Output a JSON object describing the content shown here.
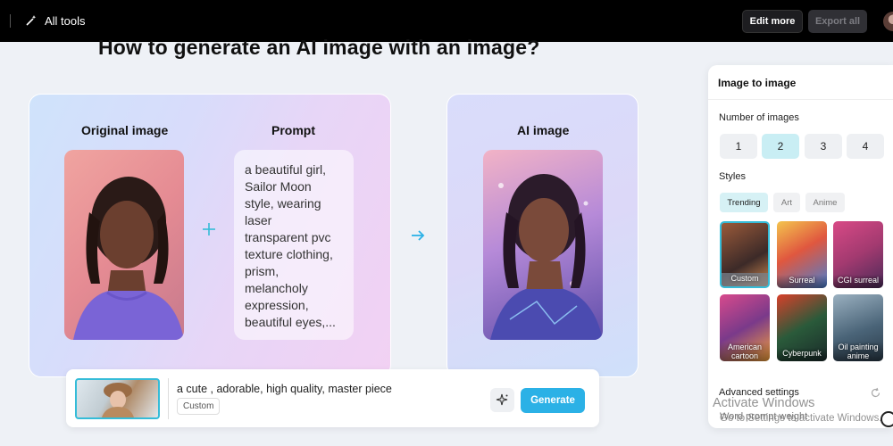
{
  "topbar": {
    "all_tools": "All tools",
    "edit_more": "Edit more",
    "export_all": "Export all"
  },
  "heading": "How to generate an AI image with an image?",
  "demo": {
    "original_title": "Original image",
    "prompt_title": "Prompt",
    "prompt_text": "a beautiful girl,\nSailor Moon\nstyle, wearing\nlaser\ntransparent pvc\ntexture clothing,\nprism,\nmelancholy\nexpression,\nbeautiful eyes,...",
    "ai_title": "AI image"
  },
  "generator": {
    "prompt_value": "a cute , adorable, high quality, master piece",
    "tag": "Custom",
    "generate_label": "Generate"
  },
  "panel": {
    "title": "Image to image",
    "num_images_label": "Number of images",
    "num_options": [
      "1",
      "2",
      "3",
      "4"
    ],
    "num_selected": "2",
    "styles_label": "Styles",
    "style_tabs": [
      "Trending",
      "Art",
      "Anime"
    ],
    "active_tab": "Trending",
    "styles": [
      "Custom",
      "Surreal",
      "CGI surreal",
      "American cartoon",
      "Cyberpunk",
      "Oil painting anime"
    ],
    "selected_style": "Custom",
    "advanced": "Advanced settings",
    "word_prompt_weight": "Word prompt weight"
  },
  "watermark": {
    "line1": "Activate Windows",
    "line2": "Go to Settings to activate Windows."
  },
  "colors": {
    "accent": "#2bb1e6",
    "selected": "#c9eef4",
    "topbar": "#000000"
  }
}
